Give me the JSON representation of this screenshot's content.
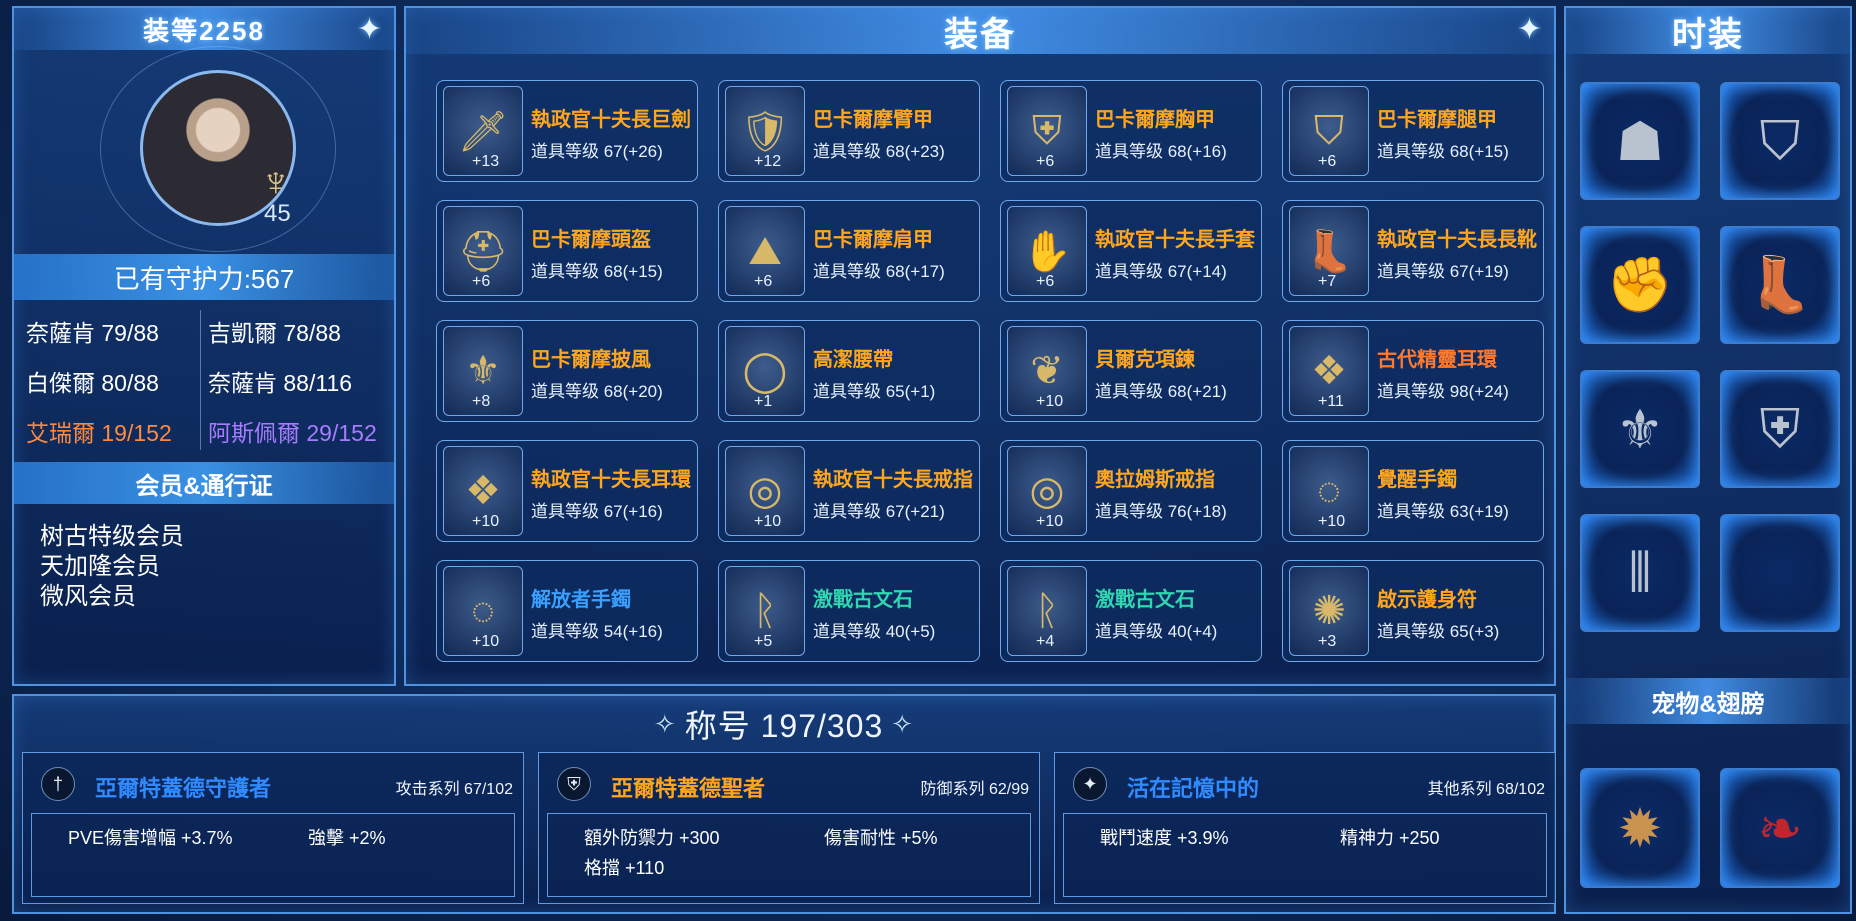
{
  "left": {
    "gear_score": "装等2258",
    "level": "45",
    "guard_power": "已有守护力:567",
    "stats": [
      {
        "text": "奈薩肯 79/88",
        "color": "white"
      },
      {
        "text": "吉凱爾 78/88",
        "color": "white"
      },
      {
        "text": "白傑爾 80/88",
        "color": "white"
      },
      {
        "text": "奈薩肯 88/116",
        "color": "white"
      },
      {
        "text": "艾瑞爾 19/152",
        "color": "#ff8a3d"
      },
      {
        "text": "阿斯佩爾 29/152",
        "color": "#a77cff"
      }
    ],
    "member_title": "会员&通行证",
    "members": [
      "树古特级会员",
      "天加隆会员",
      "微风会员"
    ]
  },
  "equip": {
    "title": "装备",
    "items": [
      {
        "name": "執政官十夫長巨劍",
        "level": "道具等级 67(+26)",
        "enh": "+13",
        "color": "#ffa51e",
        "icon": "greatsword-icon"
      },
      {
        "name": "巴卡爾摩臂甲",
        "level": "道具等级 68(+23)",
        "enh": "+12",
        "color": "#ffa51e",
        "icon": "vambrace-icon"
      },
      {
        "name": "巴卡爾摩胸甲",
        "level": "道具等级 68(+16)",
        "enh": "+6",
        "color": "#ffa51e",
        "icon": "chest-armor-icon"
      },
      {
        "name": "巴卡爾摩腿甲",
        "level": "道具等级 68(+15)",
        "enh": "+6",
        "color": "#ffa51e",
        "icon": "leg-armor-icon"
      },
      {
        "name": "巴卡爾摩頭盔",
        "level": "道具等级 68(+15)",
        "enh": "+6",
        "color": "#ffa51e",
        "icon": "helmet-icon"
      },
      {
        "name": "巴卡爾摩肩甲",
        "level": "道具等级 68(+17)",
        "enh": "+6",
        "color": "#ffa51e",
        "icon": "shoulder-armor-icon"
      },
      {
        "name": "執政官十夫長手套",
        "level": "道具等级 67(+14)",
        "enh": "+6",
        "color": "#ffa51e",
        "icon": "gloves-icon"
      },
      {
        "name": "執政官十夫長長靴",
        "level": "道具等级 67(+19)",
        "enh": "+7",
        "color": "#ffa51e",
        "icon": "boots-icon"
      },
      {
        "name": "巴卡爾摩披風",
        "level": "道具等级 68(+20)",
        "enh": "+8",
        "color": "#ffa51e",
        "icon": "cape-icon"
      },
      {
        "name": "高潔腰帶",
        "level": "道具等级 65(+1)",
        "enh": "+1",
        "color": "#ffa51e",
        "icon": "belt-icon"
      },
      {
        "name": "貝爾克項鍊",
        "level": "道具等级 68(+21)",
        "enh": "+10",
        "color": "#ffa51e",
        "icon": "necklace-icon"
      },
      {
        "name": "古代精靈耳環",
        "level": "道具等级 98(+24)",
        "enh": "+11",
        "color": "#ff7a2e",
        "icon": "earring-icon"
      },
      {
        "name": "執政官十夫長耳環",
        "level": "道具等级 67(+16)",
        "enh": "+10",
        "color": "#ffa51e",
        "icon": "earring-icon"
      },
      {
        "name": "執政官十夫長戒指",
        "level": "道具等级 67(+21)",
        "enh": "+10",
        "color": "#ffa51e",
        "icon": "ring-icon"
      },
      {
        "name": "奧拉姆斯戒指",
        "level": "道具等级 76(+18)",
        "enh": "+10",
        "color": "#ffa51e",
        "icon": "ring-icon"
      },
      {
        "name": "覺醒手鐲",
        "level": "道具等级 63(+19)",
        "enh": "+10",
        "color": "#ffa51e",
        "icon": "bracelet-icon"
      },
      {
        "name": "解放者手鐲",
        "level": "道具等级 54(+16)",
        "enh": "+10",
        "color": "#3aa0ff",
        "icon": "bracelet-icon"
      },
      {
        "name": "激戰古文石",
        "level": "道具等级 40(+5)",
        "enh": "+5",
        "color": "#2fd6b0",
        "icon": "rune-stone-icon"
      },
      {
        "name": "激戰古文石",
        "level": "道具等级 40(+4)",
        "enh": "+4",
        "color": "#2fd6b0",
        "icon": "rune-stone-icon"
      },
      {
        "name": "啟示護身符",
        "level": "道具等级 65(+3)",
        "enh": "+3",
        "color": "#ffa51e",
        "icon": "amulet-icon"
      }
    ]
  },
  "fashion": {
    "title": "时装",
    "slots": [
      "mask-icon",
      "shoulder-guard-icon",
      "gauntlet-icon",
      "boots-icon",
      "cape-icon",
      "jacket-icon",
      "pants-icon",
      "empty"
    ],
    "pet_title": "宠物&翅膀",
    "pets": [
      "pet-emblem-icon",
      "wings-icon"
    ]
  },
  "titles": {
    "heading": "称号 197/303",
    "cards": [
      {
        "name": "亞爾特蓋德守護者",
        "series": "攻击系列 67/102",
        "color": "#2f8bff",
        "icon": "sword-icon",
        "attrs": [
          "PVE傷害增幅 +3.7%",
          "強擊 +2%"
        ]
      },
      {
        "name": "亞爾特蓋德聖者",
        "series": "防御系列 62/99",
        "color": "#ffa51e",
        "icon": "shield-icon",
        "attrs": [
          "額外防禦力 +300",
          "傷害耐性 +5%",
          "格擋 +110"
        ]
      },
      {
        "name": "活在記憶中的",
        "series": "其他系列 68/102",
        "color": "#2f8bff",
        "icon": "star-icon",
        "attrs": [
          "戰鬥速度 +3.9%",
          "精神力 +250"
        ]
      }
    ]
  }
}
